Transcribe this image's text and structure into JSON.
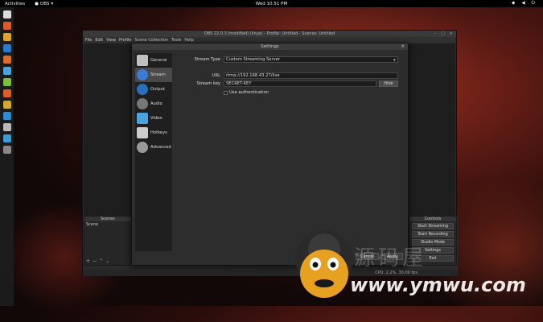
{
  "topbar": {
    "activities": "Activities",
    "app": "OBS",
    "clock": "Wed 10:51 PM"
  },
  "obs": {
    "title": "OBS 22.0.3 (modified) (linux) - Profile: Untitled - Scenes: Untitled",
    "menu": [
      "File",
      "Edit",
      "View",
      "Profile",
      "Scene Collection",
      "Tools",
      "Help"
    ],
    "scenes_header": "Scenes",
    "scene_item": "Scene",
    "controls_header": "Controls",
    "controls": [
      "Start Streaming",
      "Start Recording",
      "Studio Mode",
      "Settings",
      "Exit"
    ],
    "status": "CPU: 2.2%, 30.00 fps"
  },
  "settings": {
    "title": "Settings",
    "sidebar": [
      {
        "label": "General",
        "icon": "general-icon",
        "color": "#c0c0c0"
      },
      {
        "label": "Stream",
        "icon": "stream-icon",
        "color": "#3a7bd5"
      },
      {
        "label": "Output",
        "icon": "output-icon",
        "color": "#2a6fb8"
      },
      {
        "label": "Audio",
        "icon": "audio-icon",
        "color": "#777777"
      },
      {
        "label": "Video",
        "icon": "video-icon",
        "color": "#4aa3df"
      },
      {
        "label": "Hotkeys",
        "icon": "hotkeys-icon",
        "color": "#cccccc"
      },
      {
        "label": "Advanced",
        "icon": "advanced-icon",
        "color": "#999999"
      }
    ],
    "stream_type_label": "Stream Type",
    "stream_type_value": "Custom Streaming Server",
    "url_label": "URL",
    "url_value": "rtmp://192.168.43.27/live",
    "key_label": "Stream key",
    "key_value": "SECRET-KEY",
    "hide_label": "Hide",
    "auth_label": "Use authentication",
    "cancel_label": "Cancel",
    "apply_label": "Apply"
  },
  "watermark": {
    "text": "源码屋",
    "url": "www.ymwu.com"
  }
}
